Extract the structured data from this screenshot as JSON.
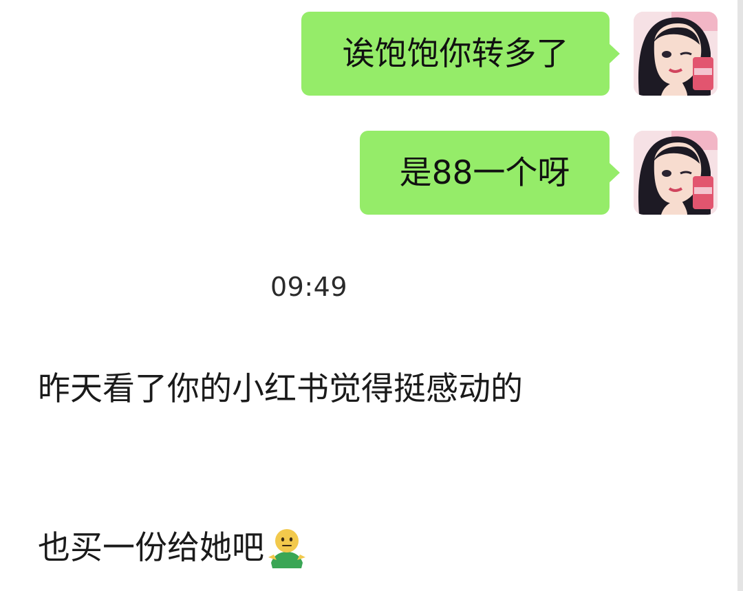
{
  "chat": {
    "messages": [
      {
        "direction": "outgoing",
        "text": "诶饱饱你转多了",
        "avatar_icon": "cartoon-girl-avatar-icon"
      },
      {
        "direction": "outgoing",
        "text": "是88一个呀",
        "avatar_icon": "cartoon-girl-avatar-icon"
      },
      {
        "direction": "incoming",
        "text": "昨天看了你的小红书觉得挺感动的"
      },
      {
        "direction": "incoming",
        "text": "也买一份给她吧",
        "emoji_icon": "shrug-person-emoji-icon"
      }
    ],
    "timestamp": "09:49"
  },
  "colors": {
    "outgoing_bubble": "#95ec69",
    "background": "#ffffff",
    "text": "#1a1a1a"
  }
}
